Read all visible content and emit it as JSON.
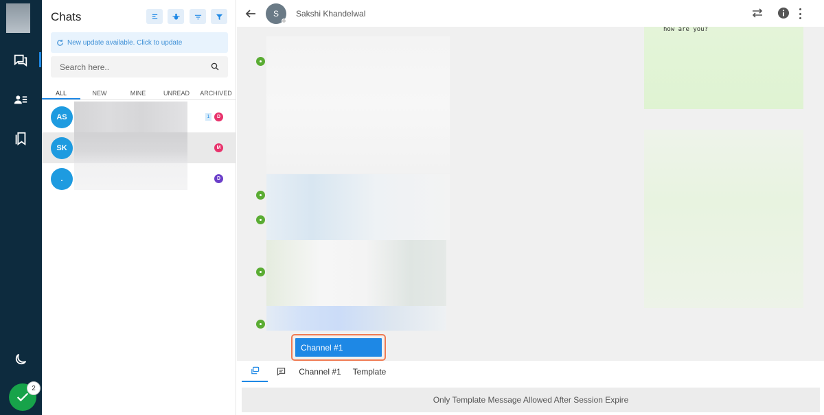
{
  "rail": {
    "notification_count": "2"
  },
  "panel": {
    "title": "Chats",
    "update_banner": "New update available. Click to update",
    "search_placeholder": "Search here..",
    "tabs": [
      "ALL",
      "NEW",
      "MINE",
      "UNREAD",
      "ARCHIVED"
    ],
    "active_tab": "ALL",
    "chats": [
      {
        "initials": "AS",
        "unread": "1",
        "agent": "D",
        "agent_color": "#e8336c",
        "selected": false
      },
      {
        "initials": "SK",
        "unread": "",
        "agent": "M",
        "agent_color": "#e8336c",
        "selected": true
      },
      {
        "initials": ".",
        "unread": "",
        "agent": "D",
        "agent_color": "#6b3fc9",
        "selected": false
      }
    ]
  },
  "conversation": {
    "contact_initial": "S",
    "contact_name": "Sakshi Khandelwal",
    "incoming_snippet": "how are you?",
    "channel_popup": "Channel #1",
    "composer_tabs": [
      "Channel #1",
      "Template"
    ],
    "composer_notice": "Only Template Message Allowed After Session Expire"
  },
  "colors": {
    "rail_bg": "#0d2b3e",
    "accent": "#1e88e5",
    "online_green": "#17a34a",
    "highlight_border": "#f07a52"
  }
}
